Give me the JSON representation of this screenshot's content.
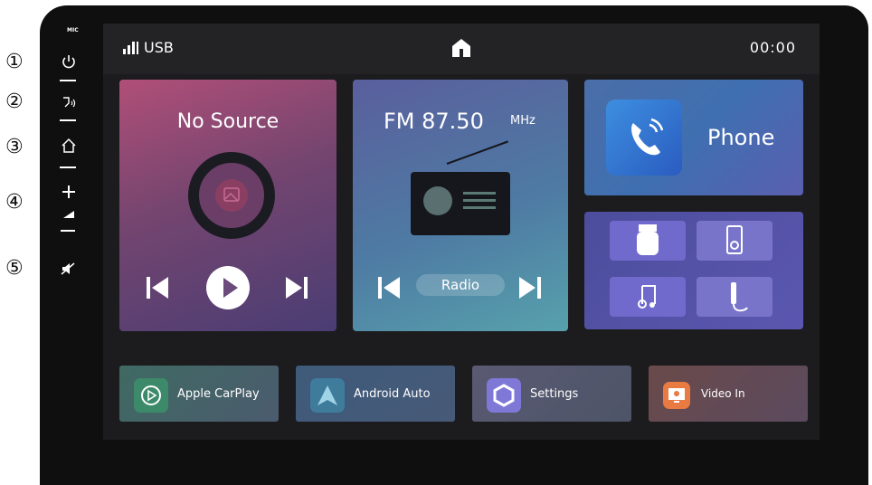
{
  "side_buttons": {
    "mic_label": "MIC",
    "numbers": [
      "①",
      "②",
      "③",
      "④",
      "⑤"
    ]
  },
  "topbar": {
    "source": "USB",
    "time": "00:00"
  },
  "media": {
    "title": "No Source"
  },
  "radio": {
    "band_freq": "FM 87.50",
    "unit": "MHz",
    "label": "Radio"
  },
  "phone": {
    "label": "Phone"
  },
  "apps": [
    {
      "label": "Apple CarPlay"
    },
    {
      "label": "Android Auto"
    },
    {
      "label": "Settings"
    },
    {
      "label": "Video In"
    }
  ]
}
